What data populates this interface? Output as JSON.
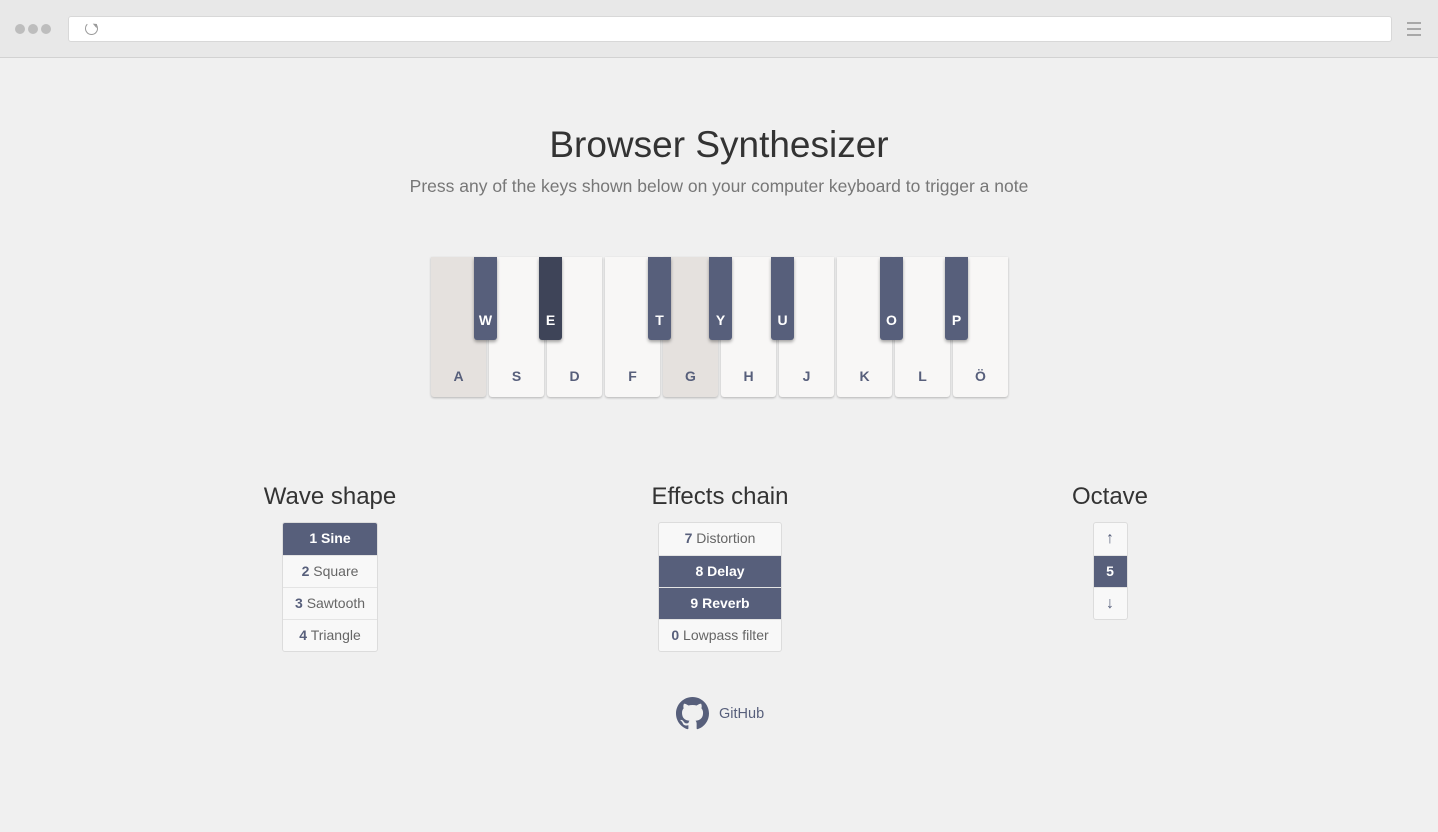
{
  "browser": {
    "address": ""
  },
  "header": {
    "title": "Browser Synthesizer",
    "subtitle": "Press any of the keys shown below on your computer keyboard to trigger a note"
  },
  "piano": {
    "white_keys": [
      {
        "label": "A",
        "active": true
      },
      {
        "label": "S",
        "active": false
      },
      {
        "label": "D",
        "active": false
      },
      {
        "label": "F",
        "active": false
      },
      {
        "label": "G",
        "active": true
      },
      {
        "label": "H",
        "active": false
      },
      {
        "label": "J",
        "active": false
      },
      {
        "label": "K",
        "active": false
      },
      {
        "label": "L",
        "active": false
      },
      {
        "label": "Ö",
        "active": false
      }
    ],
    "black_keys": [
      {
        "label": "W",
        "active": false
      },
      {
        "label": "E",
        "active": true
      },
      {
        "label": "T",
        "active": false
      },
      {
        "label": "Y",
        "active": false
      },
      {
        "label": "U",
        "active": false
      },
      {
        "label": "O",
        "active": false
      },
      {
        "label": "P",
        "active": false
      }
    ]
  },
  "wave": {
    "heading": "Wave shape",
    "items": [
      {
        "key": "1",
        "label": "Sine",
        "selected": true
      },
      {
        "key": "2",
        "label": "Square",
        "selected": false
      },
      {
        "key": "3",
        "label": "Sawtooth",
        "selected": false
      },
      {
        "key": "4",
        "label": "Triangle",
        "selected": false
      }
    ]
  },
  "effects": {
    "heading": "Effects chain",
    "items": [
      {
        "key": "7",
        "label": "Distortion",
        "selected": false
      },
      {
        "key": "8",
        "label": "Delay",
        "selected": true
      },
      {
        "key": "9",
        "label": "Reverb",
        "selected": true
      },
      {
        "key": "0",
        "label": "Lowpass filter",
        "selected": false
      }
    ]
  },
  "octave": {
    "heading": "Octave",
    "up": "↑",
    "value": "5",
    "down": "↓"
  },
  "footer": {
    "link_label": "GitHub"
  },
  "colors": {
    "accent": "#575f7b",
    "accent_active": "#3e4458",
    "background": "#f0f0f0",
    "white_key": "#f8f7f6",
    "white_key_active": "#e5e1de"
  }
}
